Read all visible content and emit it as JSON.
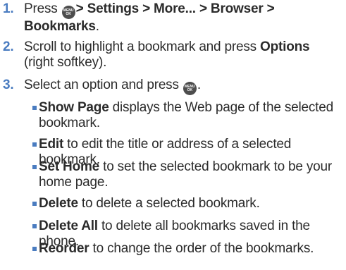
{
  "steps": [
    {
      "number": "1.",
      "pre": "Press",
      "bold": "> Settings > More... > Browser > Bookmarks",
      "post": "."
    },
    {
      "number": "2.",
      "pre": "Scroll to highlight a bookmark and press ",
      "bold": "Options",
      "post": " (right softkey)."
    },
    {
      "number": "3.",
      "pre": "Select an option and press",
      "post": "."
    }
  ],
  "key_icon": {
    "name": "menu-ok-key-icon",
    "line1": "MENU",
    "line2": "OK"
  },
  "options": [
    {
      "bold": "Show Page",
      "text": " displays the Web page of the selected bookmark."
    },
    {
      "bold": "Edit",
      "text": " to edit the title or address of a selected bookmark."
    },
    {
      "bold": "Set Home",
      "text": " to set the selected bookmark to be your home page."
    },
    {
      "bold": "Delete",
      "text": " to delete a selected bookmark."
    },
    {
      "bold": "Delete All",
      "text": " to delete all bookmarks saved in the phone."
    },
    {
      "bold": "Reorder",
      "text": " to change the order of the bookmarks."
    }
  ],
  "colors": {
    "accent": "#4a7cc0",
    "text": "#2b2b2b",
    "key": "#4d4d4d"
  }
}
